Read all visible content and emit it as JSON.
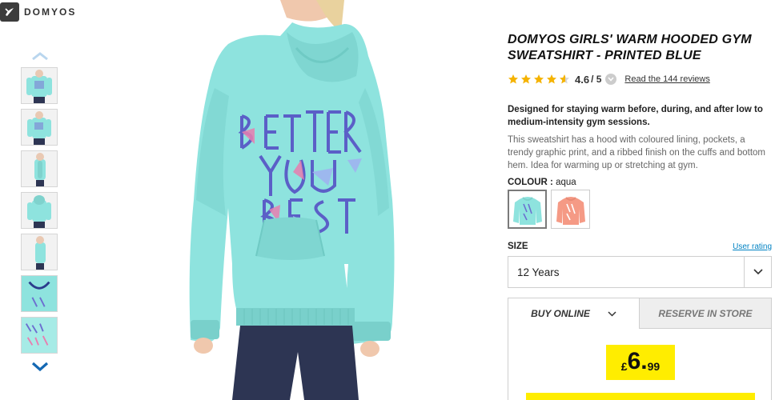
{
  "brand": {
    "name": "DOMYOS"
  },
  "product": {
    "title": "DOMYOS GIRLS' WARM HOODED GYM SWEATSHIRT - PRINTED BLUE",
    "rating_value": "4.6",
    "rating_suffix": "/ 5",
    "rating_stars": 4.6,
    "reviews_link": "Read the 144 reviews",
    "description_bold": "Designed for staying warm before, during, and after low to medium-intensity gym sessions.",
    "description": "This sweatshirt has a hood with coloured lining, pockets, a trendy graphic print, and a ribbed finish on the cuffs and bottom hem. Idea for warming up or stretching at gym."
  },
  "colour": {
    "label": "COLOUR :",
    "value": "aqua",
    "swatches": [
      "aqua",
      "coral"
    ]
  },
  "size": {
    "label": "SIZE",
    "rating_link": "User rating",
    "selected": "12 Years"
  },
  "purchase": {
    "tab_buy": "BUY ONLINE",
    "tab_reserve": "RESERVE IN STORE",
    "currency": "£",
    "price_int": "6.",
    "price_dec": "99"
  },
  "colors": {
    "accent_yellow": "#ffed00",
    "link_blue": "#0082c3",
    "star_gold": "#f5b300",
    "product_aqua": "#8ee3de",
    "product_coral": "#f59a85"
  }
}
